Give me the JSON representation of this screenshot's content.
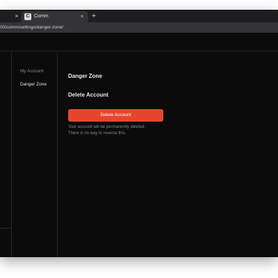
{
  "browser": {
    "active_tab": {
      "favicon_letter": "C",
      "title": "Comm"
    },
    "tab_close_glyph": "×",
    "new_tab_glyph": "+",
    "url": "00/comm/settings/danger-zone/"
  },
  "settings_nav": {
    "items": [
      {
        "label": "My Account",
        "active": false
      },
      {
        "label": "Danger Zone",
        "active": true
      }
    ]
  },
  "main": {
    "title": "Danger Zone",
    "section_title": "Delete Account",
    "delete_button_label": "Delete Account",
    "warning_line_1": "Your account will be permanently deleted.",
    "warning_line_2": "There is no way to reverse this."
  },
  "colors": {
    "background": "#0b0b0b",
    "danger": "#e5472d",
    "muted_text": "#8a8a8a"
  }
}
